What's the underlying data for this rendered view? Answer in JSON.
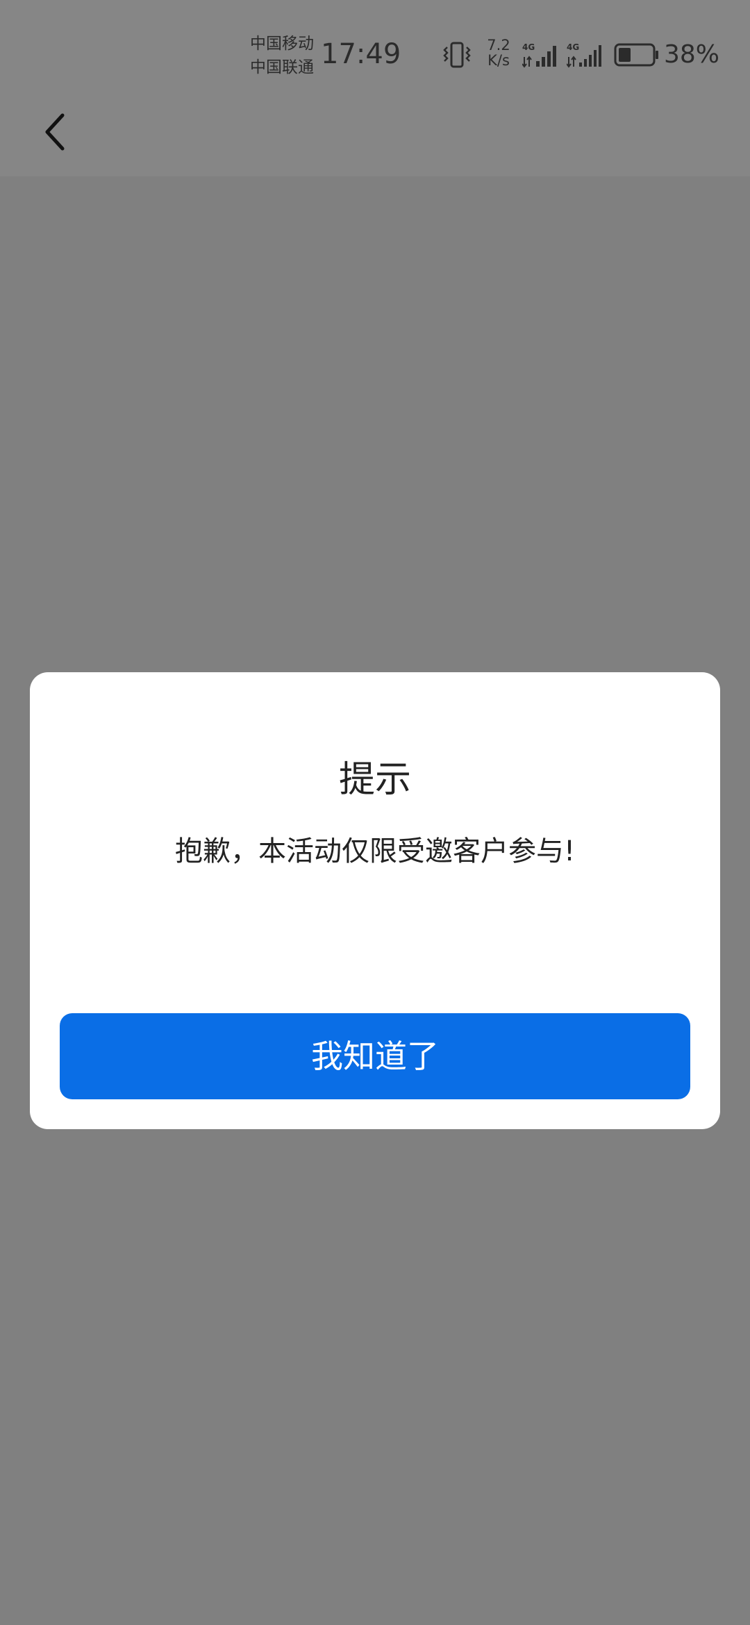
{
  "status_bar": {
    "carrier_1": "中国移动",
    "carrier_2": "中国联通",
    "time": "17:49",
    "network_speed_value": "7.2",
    "network_speed_unit": "K/s",
    "signal_1_label": "4G",
    "signal_2_label": "4G",
    "battery_percent": "38%",
    "battery_level": 0.38,
    "icons": [
      "vibrate-icon",
      "signal-icon",
      "signal-icon",
      "battery-icon"
    ]
  },
  "nav": {
    "back_icon": "chevron-left-icon"
  },
  "dialog": {
    "title": "提示",
    "message": "抱歉，本活动仅限受邀客户参与!",
    "confirm_label": "我知道了"
  },
  "colors": {
    "overlay": "#808080",
    "dialog_bg": "#ffffff",
    "primary_button": "#0a6ee6",
    "text": "#222222"
  }
}
